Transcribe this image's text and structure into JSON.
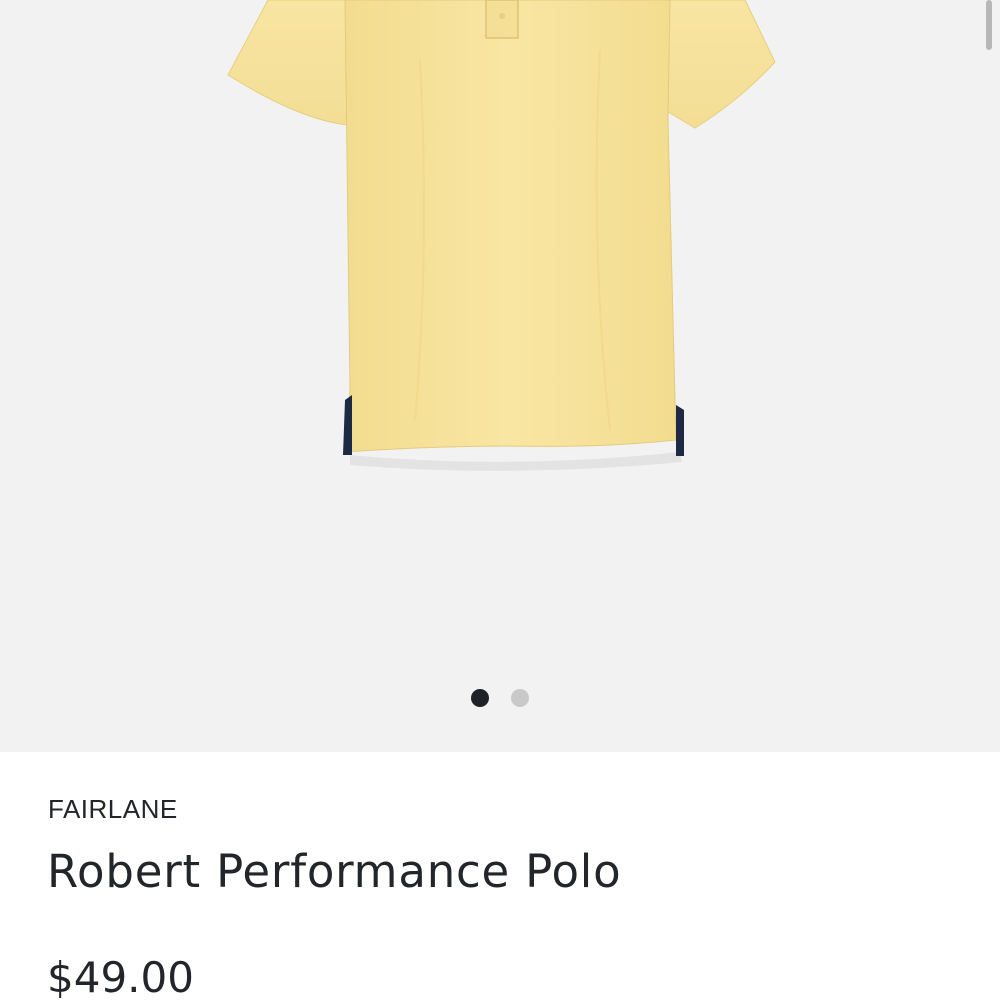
{
  "gallery": {
    "image_alt": "Yellow short-sleeve polo shirt",
    "dots": [
      {
        "active": true
      },
      {
        "active": false
      }
    ]
  },
  "product": {
    "brand": "FAIRLANE",
    "name": "Robert Performance Polo",
    "price": "$49.00"
  },
  "colors": {
    "shirt": "#f7e39c",
    "gallery_background": "#f2f2f2",
    "text": "#222529",
    "dot_active": "#1e2127",
    "dot_inactive": "#c9c9c9"
  }
}
